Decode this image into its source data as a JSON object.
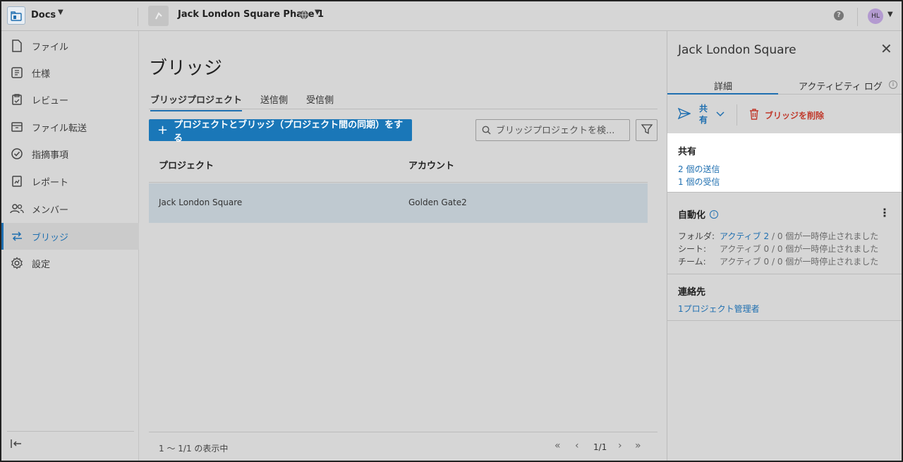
{
  "header": {
    "app_label": "Docs",
    "project_name": "Jack London Square Phase 1",
    "avatar_initials": "HL",
    "help_icon": "help-icon"
  },
  "sidebar": {
    "items": [
      {
        "label": "ファイル",
        "icon": "file-icon"
      },
      {
        "label": "仕様",
        "icon": "spec-icon"
      },
      {
        "label": "レビュー",
        "icon": "review-icon"
      },
      {
        "label": "ファイル転送",
        "icon": "transfer-icon"
      },
      {
        "label": "指摘事項",
        "icon": "issues-icon"
      },
      {
        "label": "レポート",
        "icon": "report-icon"
      },
      {
        "label": "メンバー",
        "icon": "members-icon"
      },
      {
        "label": "ブリッジ",
        "icon": "bridge-icon",
        "active": true
      },
      {
        "label": "設定",
        "icon": "settings-icon"
      }
    ]
  },
  "main": {
    "title": "ブリッジ",
    "tabs": [
      {
        "label": "ブリッジプロジェクト",
        "active": true
      },
      {
        "label": "送信側"
      },
      {
        "label": "受信側"
      }
    ],
    "add_button": "プロジェクトとブリッジ（プロジェクト間の同期）をする",
    "search_placeholder": "ブリッジプロジェクトを検...",
    "table": {
      "columns": [
        "プロジェクト",
        "アカウント"
      ],
      "rows": [
        {
          "project": "Jack London Square",
          "account": "Golden Gate2"
        }
      ]
    },
    "pagination": {
      "summary": "1 〜 1/1 の表示中",
      "page": "1/1"
    }
  },
  "panel": {
    "title": "Jack London Square",
    "tabs": [
      "詳細",
      "アクティビティ ログ"
    ],
    "share_button": "共有",
    "delete_button": "ブリッジを削除",
    "share_section": {
      "heading": "共有",
      "sent": "2 個の送信",
      "received": "1 個の受信"
    },
    "automation": {
      "heading": "自動化",
      "rows": [
        {
          "key": "フォルダ:",
          "active": "アクティブ 2",
          "rest": "/ 0 個が一時停止されました"
        },
        {
          "key": "シート:",
          "active": "アクティブ 0",
          "rest": "/ 0 個が一時停止されました"
        },
        {
          "key": "チーム:",
          "active": "アクティブ 0",
          "rest": "/ 0 個が一時停止されました"
        }
      ]
    },
    "contact": {
      "heading": "連絡先",
      "link": "1プロジェクト管理者"
    }
  },
  "colors": {
    "accent": "#1f6fb0",
    "button": "#1a77b8",
    "danger": "#c0392b",
    "selected_row": "#bfc9d0"
  }
}
